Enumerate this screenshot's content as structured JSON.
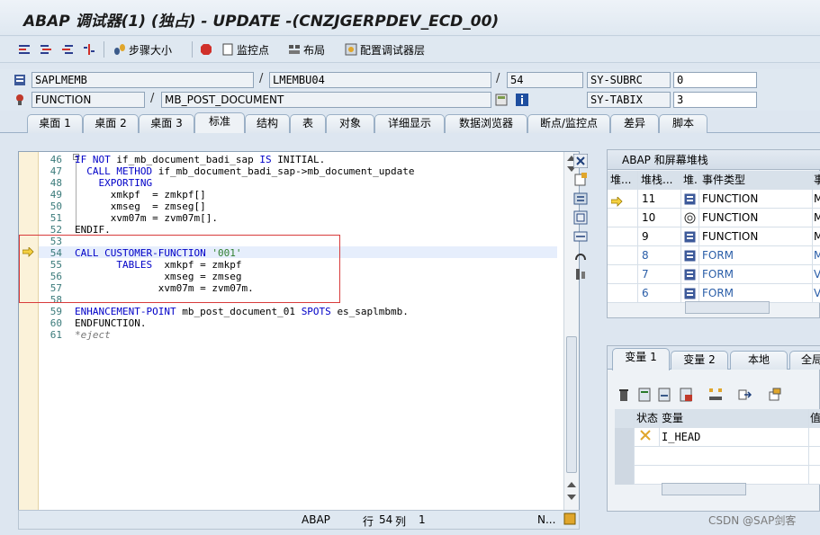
{
  "window": {
    "title": "ABAP 调试器(1) (独占) - UPDATE -(CNZJGERPDEV_ECD_00)"
  },
  "toolbar": {
    "step_size_label": "步骤大小",
    "watchpoint_label": "监控点",
    "layout_label": "布局",
    "configure_label": "配置调试器层"
  },
  "info": {
    "program": "SAPLMEMB",
    "include": "LMEMBU04",
    "line": "54",
    "subrc_name": "SY-SUBRC",
    "subrc_value": "0",
    "event_type": "FUNCTION",
    "event_name": "MB_POST_DOCUMENT",
    "tabix_name": "SY-TABIX",
    "tabix_value": "3"
  },
  "tabs": [
    "桌面 1",
    "桌面 2",
    "桌面 3",
    "标准",
    "结构",
    "表",
    "对象",
    "详细显示",
    "数据浏览器",
    "断点/监控点",
    "差异",
    "脚本"
  ],
  "code": {
    "line_numbers": [
      "46",
      "47",
      "48",
      "49",
      "50",
      "51",
      "52",
      "53",
      "54",
      "55",
      "56",
      "57",
      "58",
      "59",
      "60",
      "61"
    ],
    "lines": [
      "IF NOT if_mb_document_badi_sap IS INITIAL.",
      "  CALL METHOD if_mb_document_badi_sap->mb_document_update",
      "    EXPORTING",
      "      xmkpf  = zmkpf[]",
      "      xmseg  = zmseg[]",
      "      xvm07m = zvm07m[].",
      "ENDIF.",
      "",
      "CALL CUSTOMER-FUNCTION '001'",
      "       TABLES  xmkpf = zmkpf",
      "               xmseg = zmseg",
      "              xvm07m = zvm07m.",
      "",
      "ENHANCEMENT-POINT mb_post_document_01 SPOTS es_saplmbmb.",
      "ENDFUNCTION.",
      "*eject"
    ]
  },
  "status": {
    "lang": "ABAP",
    "row_label": "行",
    "row": "54",
    "col_label": "列",
    "col": "1",
    "mode": "N..."
  },
  "stack": {
    "title": "ABAP 和屏幕堆栈",
    "headers": [
      "堆...",
      "堆栈...",
      "堆.",
      "事件类型",
      "事"
    ],
    "rows": [
      {
        "level": "11",
        "type": "FUNCTION",
        "prog": "M"
      },
      {
        "level": "10",
        "type": "FUNCTION",
        "prog": "M"
      },
      {
        "level": "9",
        "type": "FUNCTION",
        "prog": "M"
      },
      {
        "level": "8",
        "type": "FORM",
        "prog": "M"
      },
      {
        "level": "7",
        "type": "FORM",
        "prog": "V"
      },
      {
        "level": "6",
        "type": "FORM",
        "prog": "V"
      }
    ]
  },
  "variables": {
    "tabs": [
      "变量 1",
      "变量 2",
      "本地",
      "全局"
    ],
    "headers": [
      "状态",
      "变量",
      "值"
    ],
    "rows": [
      {
        "name": "I_HEAD"
      }
    ]
  },
  "watermark": "CSDN @SAP剑客",
  "colors": {
    "keyword": "#0000c8",
    "string": "#2f7f2f",
    "comment": "#777777",
    "breakbox": "#d83b3b"
  }
}
